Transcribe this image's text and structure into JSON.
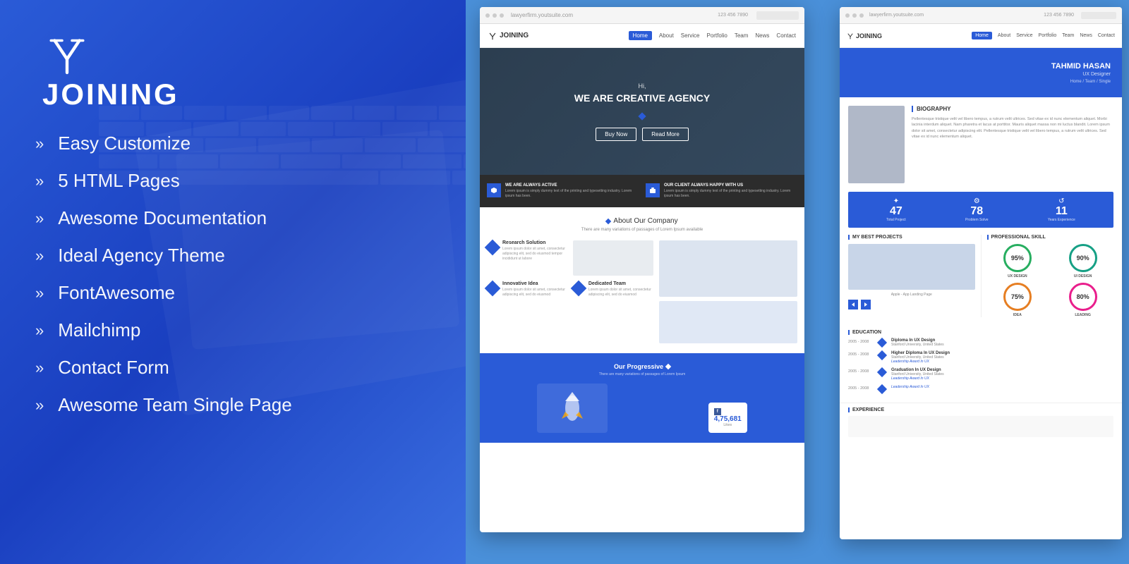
{
  "brand": {
    "logo_text": "JOINING",
    "logo_icon": "✦"
  },
  "features": [
    {
      "id": "easy-customize",
      "label": "Easy Customize"
    },
    {
      "id": "html-pages",
      "label": "5 HTML Pages"
    },
    {
      "id": "awesome-documentation",
      "label": "Awesome Documentation"
    },
    {
      "id": "ideal-agency",
      "label": "Ideal Agency Theme"
    },
    {
      "id": "fontawesome",
      "label": "FontAwesome"
    },
    {
      "id": "mailchimp",
      "label": "Mailchimp"
    },
    {
      "id": "contact-form",
      "label": "Contact Form"
    },
    {
      "id": "team-page",
      "label": "Awesome Team Single Page"
    }
  ],
  "preview_main": {
    "browser_url": "lawyerfirm.youtsuite.com",
    "browser_phone": "123 456 7890",
    "nav_logo": "JOINING",
    "nav_items": [
      "Home",
      "About",
      "Service",
      "Portfolio",
      "Team",
      "News",
      "Contact"
    ],
    "nav_active": "Home",
    "hero_subtitle": "Hi,",
    "hero_title": "WE ARE CREATIVE AGENCY",
    "hero_btn1": "Buy Now",
    "hero_btn2": "Read More",
    "stats": [
      {
        "title": "WE ARE ALWAYS ACTIVE",
        "desc": "Lorem ipsum is simply dummy text of the printing and typesetting industry. Lorem ipsum has been."
      },
      {
        "title": "OUR CLIENT ALWAYS HAPPY WITH US",
        "desc": "Lorem ipsum is simply dummy text of the printing and typesetting industry. Lorem ipsum has been."
      }
    ],
    "about_heading": "About Our Company",
    "about_subtext": "There are many variations of passages of Lorem Ipsum available",
    "about_features": [
      {
        "title": "Research Solution",
        "desc": "Lorem ipsum dolor sit amet, consectetur adipiscing elit, sed do eiusmod tempor incididunt ut labore"
      },
      {
        "title": "Innovative Idea",
        "desc": "Lorem ipsum dolor sit amet, consectetur adipiscing elit, sed do eiusmod"
      },
      {
        "title": "",
        "desc": ""
      },
      {
        "title": "Dedicated Team",
        "desc": "Lorem ipsum dolor sit amet, consectetur adipiscing elit, sed do eiusmod"
      }
    ],
    "progressive_heading": "Our Progressive",
    "progressive_subtext": "There are many variations of passages of Lorem Ipsum",
    "social_likes": "4,75,681",
    "social_label": "Likes"
  },
  "preview_secondary": {
    "browser_url": "lawyerfirm.youtsuite.com",
    "browser_phone": "123 456 7890",
    "nav_logo": "JOINING",
    "nav_items": [
      "Home",
      "About",
      "Service",
      "Portfolio",
      "Team",
      "News",
      "Contact"
    ],
    "nav_active": "Home",
    "profile_name": "TAHMID HASAN",
    "profile_role": "UX Designer",
    "profile_breadcrumb": "Home / Team / Single",
    "bio_title": "BIOGRAPHY",
    "bio_text": "Pellentesque tristique velit vel libero tempus, a rutrum velit ultrices. Sed vitae ex id nunc elementum aliquet. Morbi lacinia interdum aliquet. Nam pharetra et lacus at porttitor. Mauris aliquet massa non mi luctus blandit. Lorem ipsum dolor sit amet, consectetur adipiscing elit. Pellentesque tristique velit vel libero tempus, a rutrum velit ultrices. Sed vitae ex id nunc elementum aliquet.",
    "stats": [
      {
        "label": "Total Project",
        "value": "47",
        "icon": "✦"
      },
      {
        "label": "Problem Solve",
        "value": "78",
        "icon": "⚙"
      },
      {
        "label": "Years Experience",
        "value": "11",
        "icon": "↺"
      }
    ],
    "projects_title": "MY BEST PROJECTS",
    "skills_title": "PROFESSIONAL SKILL",
    "skills": [
      {
        "name": "UX DESIGN",
        "value": "95%",
        "color": "green"
      },
      {
        "name": "UI DESIGN",
        "value": "90%",
        "color": "teal"
      },
      {
        "name": "IDEA",
        "value": "75%",
        "color": "orange"
      },
      {
        "name": "LEADING",
        "value": "80%",
        "color": "pink"
      }
    ],
    "education_title": "EDUCATION",
    "education": [
      {
        "years": "2005 - 2008",
        "degree": "Diploma In UX Design",
        "school": "Stanford University, United States",
        "award": ""
      },
      {
        "years": "2005 - 2008",
        "degree": "Higher Diploma In UX Design",
        "school": "Stanford University, United States",
        "award": "Leadership Award In UX"
      },
      {
        "years": "2005 - 2008",
        "degree": "Graduation In UX Design",
        "school": "Stanford University, United States",
        "award": "Leadership Award In UX"
      },
      {
        "years": "2005 - 2008",
        "degree": "",
        "school": "",
        "award": "Leadership Award In UX"
      }
    ],
    "experience_title": "EXPERIENCE"
  }
}
